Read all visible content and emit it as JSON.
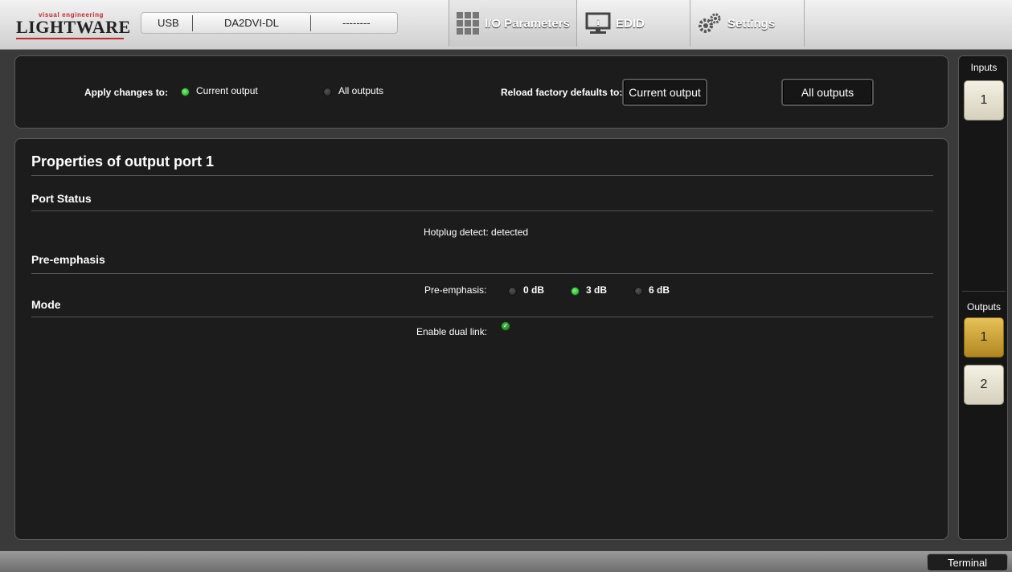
{
  "header": {
    "logo_small": "visual engineering",
    "logo_big": "LIGHTWARE",
    "connection": {
      "interface": "USB",
      "device": "DA2DVI-DL",
      "status": "--------"
    },
    "tabs": [
      {
        "label": "I/O Parameters",
        "icon": "grid-icon",
        "active": true
      },
      {
        "label": "EDID",
        "icon": "monitor-info-icon",
        "active": false
      },
      {
        "label": "Settings",
        "icon": "gears-icon",
        "active": false
      }
    ]
  },
  "apply": {
    "label": "Apply changes to:",
    "options": [
      {
        "label": "Current output",
        "selected": true
      },
      {
        "label": "All outputs",
        "selected": false
      }
    ],
    "reload_label": "Reload factory defaults to:",
    "reload_current_button": "Current output",
    "reload_all_button": "All outputs"
  },
  "properties": {
    "title": "Properties of output port 1",
    "port_status": {
      "heading": "Port Status",
      "hotplug": "Hotplug detect: detected"
    },
    "pre_emphasis": {
      "heading": "Pre-emphasis",
      "label": "Pre-emphasis:",
      "options": [
        {
          "label": "0 dB",
          "selected": false
        },
        {
          "label": "3 dB",
          "selected": true
        },
        {
          "label": "6 dB",
          "selected": false
        }
      ]
    },
    "mode": {
      "heading": "Mode",
      "dual_link_label": "Enable dual link:",
      "dual_link_enabled": true
    }
  },
  "sidebar": {
    "inputs_label": "Inputs",
    "inputs": [
      "1"
    ],
    "outputs_label": "Outputs",
    "outputs": [
      "1",
      "2"
    ],
    "selected_output": "1"
  },
  "footer": {
    "terminal_button": "Terminal"
  },
  "colors": {
    "panel_bg": "#1c1c1c",
    "selected_output": "#d4a93a",
    "radio_on": "#2fbf2f"
  }
}
